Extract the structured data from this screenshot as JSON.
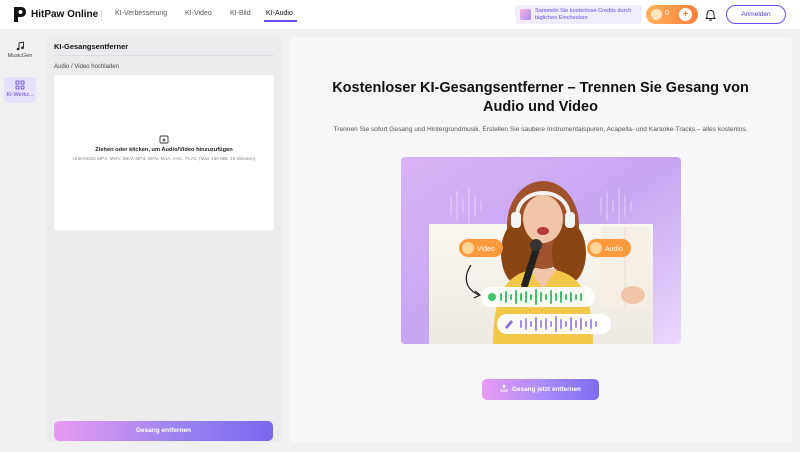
{
  "brand": {
    "name": "HitPaw Online"
  },
  "nav": {
    "items": [
      {
        "label": "KI-Verbesserung"
      },
      {
        "label": "KI-Video"
      },
      {
        "label": "KI-Bild"
      },
      {
        "label": "KI-Audio",
        "active": true
      }
    ]
  },
  "header": {
    "promo_text": "Sammeln Sie kostenlose Credits durch tägliches Einchecken",
    "credits": "0",
    "credits_plus": "+",
    "login_label": "Anmelden"
  },
  "rail": {
    "items": [
      {
        "label": "MusicGen",
        "icon": "music-note-icon"
      },
      {
        "label": "KI-Werkz...",
        "icon": "tools-grid-icon",
        "active": true
      }
    ]
  },
  "left_panel": {
    "title": "KI-Gesangsentferner",
    "upload_label": "Audio / Video hochladen",
    "drop_main": "Ziehen oder klicken, um Audio/Video hinzuzufügen",
    "drop_sub": "Unterstützt MP4, MOV, MKV, MP3, WAV, M4A, AAC, FLAC (Max 150 MB, 15 Minuten)",
    "remove_button": "Gesang entfernen"
  },
  "hero": {
    "title": "Kostenloser KI-Gesangsentferner – Trennen Sie Gesang von Audio und Video",
    "description": "Trennen Sie sofort Gesang und Hintergrundmusik. Erstellen Sie saubere Instrumentalspuren, Acapella- und Karaoke-Tracks – alles kostenlos.",
    "badge_video": "Video",
    "badge_audio": "Audio",
    "cta_label": "Gesang jetzt entfernen"
  },
  "colors": {
    "accent": "#6b4cf3",
    "credits_orange": "#ff8a3d",
    "voice_track": "#3fc46b",
    "music_track": "#8b6cf0"
  }
}
